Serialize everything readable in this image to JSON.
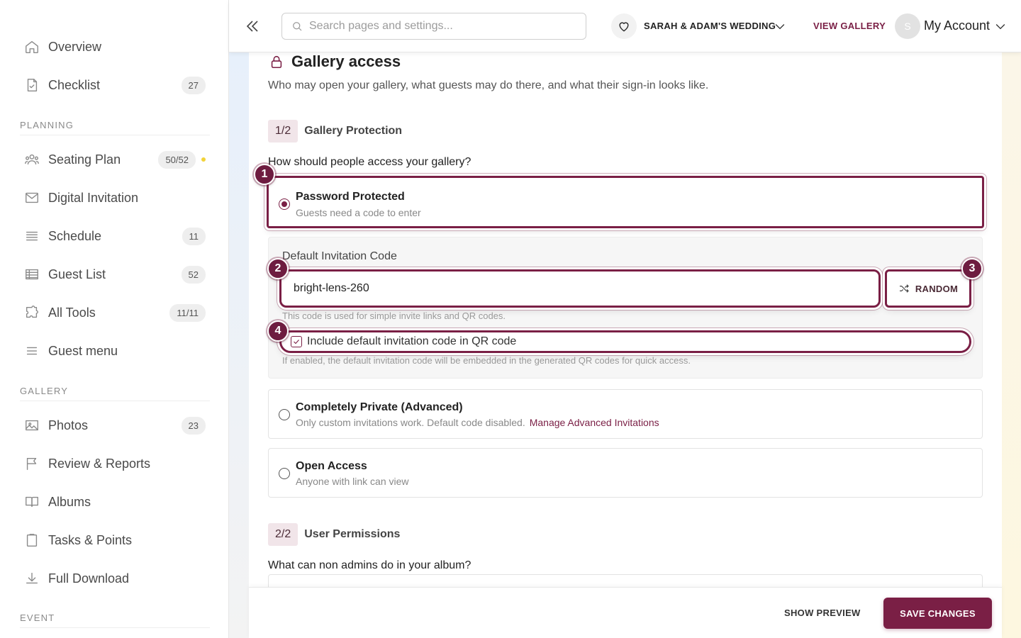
{
  "sidebar": {
    "items": [
      {
        "label": "Overview",
        "icon": "home-icon",
        "badge": ""
      },
      {
        "label": "Checklist",
        "icon": "checklist-icon",
        "badge": "27"
      },
      {
        "label": "Seating Plan",
        "icon": "people-icon",
        "badge": "50/52"
      },
      {
        "label": "Digital Invitation",
        "icon": "mail-icon",
        "badge": ""
      },
      {
        "label": "Schedule",
        "icon": "list-icon",
        "badge": "11"
      },
      {
        "label": "Guest List",
        "icon": "table-icon",
        "badge": "52"
      },
      {
        "label": "All Tools",
        "icon": "puzzle-icon",
        "badge": "11/11"
      },
      {
        "label": "Guest menu",
        "icon": "menu-icon",
        "badge": ""
      },
      {
        "label": "Photos",
        "icon": "image-icon",
        "badge": "23"
      },
      {
        "label": "Review & Reports",
        "icon": "flag-icon",
        "badge": ""
      },
      {
        "label": "Albums",
        "icon": "book-icon",
        "badge": ""
      },
      {
        "label": "Tasks & Points",
        "icon": "clipboard-icon",
        "badge": ""
      },
      {
        "label": "Full Download",
        "icon": "download-icon",
        "badge": ""
      }
    ],
    "sections": {
      "planning": "PLANNING",
      "gallery": "GALLERY",
      "event": "EVENT"
    }
  },
  "topbar": {
    "search_placeholder": "Search pages and settings...",
    "event_name": "SARAH & ADAM'S WEDDING",
    "view_gallery": "VIEW GALLERY",
    "avatar_initial": "S",
    "account": "My Account"
  },
  "main": {
    "title": "Gallery access",
    "subtitle": "Who may open your gallery, what guests may do there, and what their sign-in looks like.",
    "step1": {
      "num": "1/2",
      "label": "Gallery Protection"
    },
    "question1": "How should people access your gallery?",
    "options": {
      "password": {
        "title": "Password Protected",
        "desc": "Guests need a code to enter",
        "selected": true
      },
      "private": {
        "title": "Completely Private (Advanced)",
        "desc": "Only custom invitations work. Default code disabled.",
        "link": "Manage Advanced Invitations"
      },
      "open": {
        "title": "Open Access",
        "desc": "Anyone with link can view"
      }
    },
    "code": {
      "label": "Default Invitation Code",
      "value": "bright-lens-260",
      "random_label": "RANDOM",
      "help": "This code is used for simple invite links and QR codes.",
      "include_label": "Include default invitation code in QR code",
      "include_checked": true,
      "include_help": "If enabled, the default invitation code will be embedded in the generated QR codes for quick access."
    },
    "step2": {
      "num": "2/2",
      "label": "User Permissions"
    },
    "question2": "What can non admins do in your album?"
  },
  "markers": [
    "1",
    "2",
    "3",
    "4"
  ],
  "footer": {
    "preview": "SHOW PREVIEW",
    "save": "SAVE CHANGES"
  },
  "colors": {
    "accent": "#7a1f45",
    "badge_dot": "#f2d33a"
  }
}
